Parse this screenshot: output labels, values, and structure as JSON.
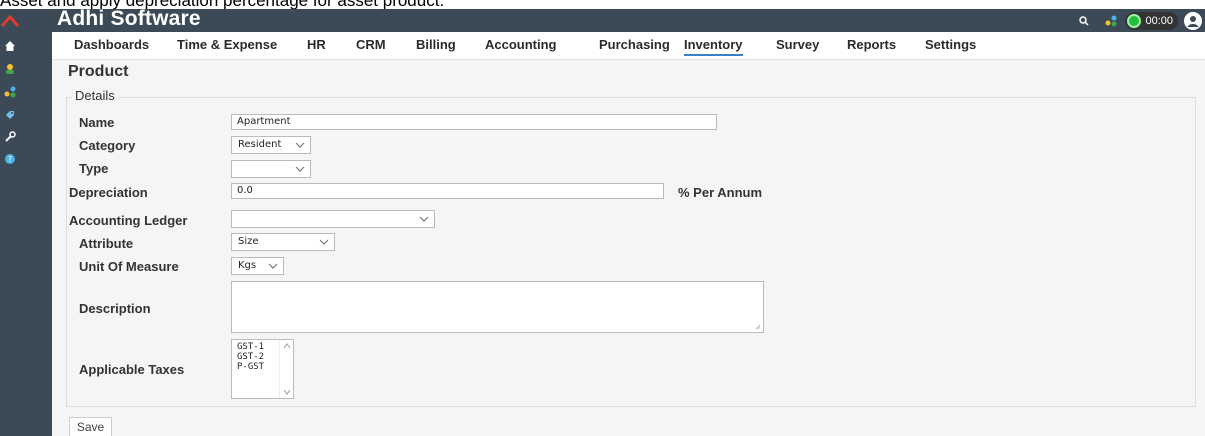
{
  "caption": "Asset and apply depreciation percentage for asset product.",
  "app": {
    "brand": "Adhi Software",
    "timer": "00:00"
  },
  "sidebar": [
    {
      "icon": "home-icon"
    },
    {
      "icon": "user-icon"
    },
    {
      "icon": "share-icon"
    },
    {
      "icon": "tag-icon",
      "active": true
    },
    {
      "icon": "wrench-icon"
    },
    {
      "icon": "help-icon"
    }
  ],
  "nav": {
    "items": [
      "Dashboards",
      "Time & Expense",
      "HR",
      "CRM",
      "Billing",
      "Accounting",
      "Purchasing",
      "Inventory",
      "Survey",
      "Reports",
      "Settings"
    ],
    "active": "Inventory"
  },
  "page": {
    "title": "Product",
    "section": "Details"
  },
  "form": {
    "name": {
      "label": "Name",
      "value": "Apartment"
    },
    "category": {
      "label": "Category",
      "value": "Resident"
    },
    "type": {
      "label": "Type",
      "value": ""
    },
    "depreciation": {
      "label": "Depreciation",
      "value": "0.0",
      "suffix": "% Per Annum"
    },
    "accounting_ledger": {
      "label": "Accounting Ledger",
      "value": ""
    },
    "attribute": {
      "label": "Attribute",
      "value": "Size"
    },
    "unit": {
      "label": "Unit Of Measure",
      "value": "Kgs"
    },
    "description": {
      "label": "Description",
      "value": ""
    },
    "taxes": {
      "label": "Applicable Taxes",
      "options": [
        "GST-1",
        "GST-2",
        "P-GST"
      ]
    }
  },
  "buttons": {
    "save": "Save"
  },
  "colors": {
    "sidebar": "#3b4a56",
    "accent": "#3b7fc4",
    "timer": "#22c03a"
  }
}
